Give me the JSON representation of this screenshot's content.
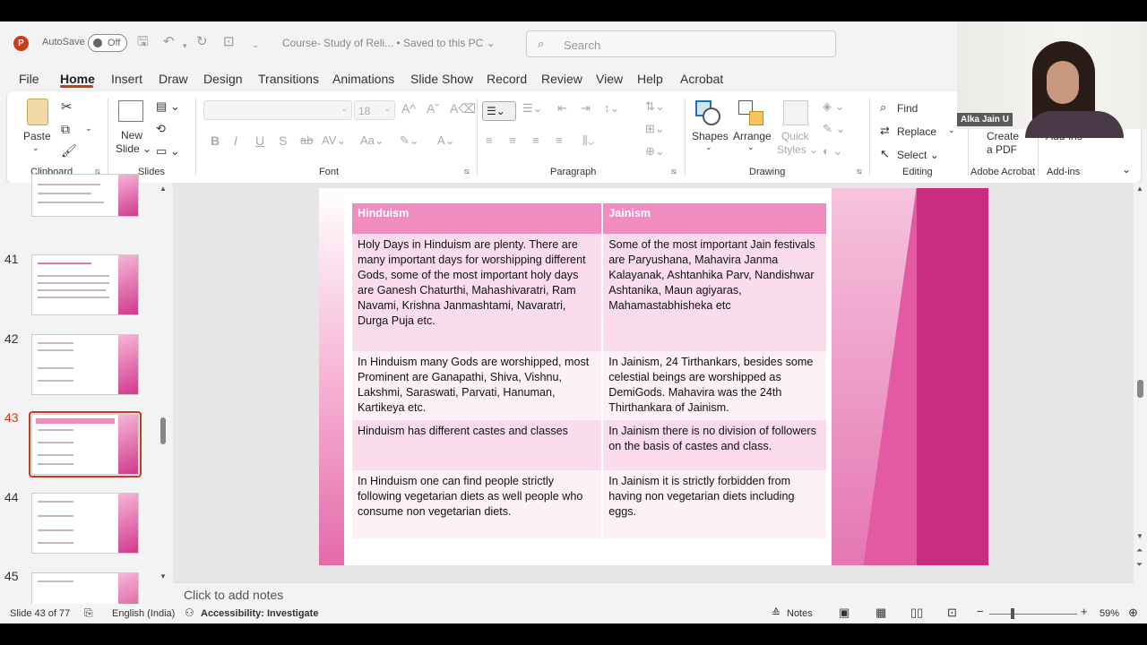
{
  "titlebar": {
    "app_icon": "P",
    "autosave_label": "AutoSave",
    "autosave_state": "Off",
    "doc_title": "Course- Study of Reli...",
    "save_status": "Saved to this PC",
    "search_placeholder": "Search"
  },
  "menu": [
    "File",
    "Home",
    "Insert",
    "Draw",
    "Design",
    "Transitions",
    "Animations",
    "Slide Show",
    "Record",
    "Review",
    "View",
    "Help",
    "Acrobat"
  ],
  "ribbon": {
    "paste": "Paste",
    "clipboard": "Clipboard",
    "new_slide_1": "New",
    "new_slide_2": "Slide",
    "slides": "Slides",
    "font_size": "18",
    "font": "Font",
    "paragraph": "Paragraph",
    "shapes": "Shapes",
    "arrange": "Arrange",
    "quick_styles_1": "Quick",
    "quick_styles_2": "Styles",
    "drawing": "Drawing",
    "find": "Find",
    "replace": "Replace",
    "select": "Select",
    "editing": "Editing",
    "create_pdf_1": "Create",
    "create_pdf_2": "a PDF",
    "adobe_acrobat": "Adobe Acrobat",
    "addins_btn": "Add-ins",
    "addins_group": "Add-ins"
  },
  "video": {
    "name": "Alka Jain U"
  },
  "thumbnails": [
    "41",
    "42",
    "43",
    "44",
    "45"
  ],
  "slide": {
    "headers": [
      "Hinduism",
      "Jainism"
    ],
    "rows": [
      [
        "Holy Days in Hinduism are plenty. There are many important days for worshipping different Gods, some of the most important holy days are Ganesh Chaturthi, Mahashivaratri, Ram Navami, Krishna Janmashtami, Navaratri, Durga Puja etc.",
        "Some of the most important Jain festivals are Paryushana, Mahavira Janma Kalayanak, Ashtanhika Parv, Nandishwar Ashtanika, Maun agiyaras, Mahamastabhisheka etc"
      ],
      [
        "In Hinduism many Gods are worshipped, most Prominent are Ganapathi, Shiva, Vishnu, Lakshmi, Saraswati, Parvati, Hanuman, Kartikeya etc.",
        "In Jainism, 24 Tirthankars, besides some celestial beings are worshipped as DemiGods. Mahavira was the 24th Thirthankara of Jainism."
      ],
      [
        "Hinduism has different castes and classes",
        "In Jainism there is no division of followers on the basis of castes and class."
      ],
      [
        "In Hinduism one can find people strictly following vegetarian diets as well people who consume non vegetarian diets.",
        "In Jainism it is strictly forbidden from having non vegetarian diets including eggs."
      ]
    ]
  },
  "notes_placeholder": "Click to add notes",
  "status": {
    "slide_of": "Slide 43 of 77",
    "language": "English (India)",
    "accessibility": "Accessibility: Investigate",
    "notes": "Notes",
    "zoom": "59%"
  },
  "colors": {
    "accent": "#c43e1c",
    "table_header": "#f08cc0",
    "slide_pink": "#c92d80"
  }
}
